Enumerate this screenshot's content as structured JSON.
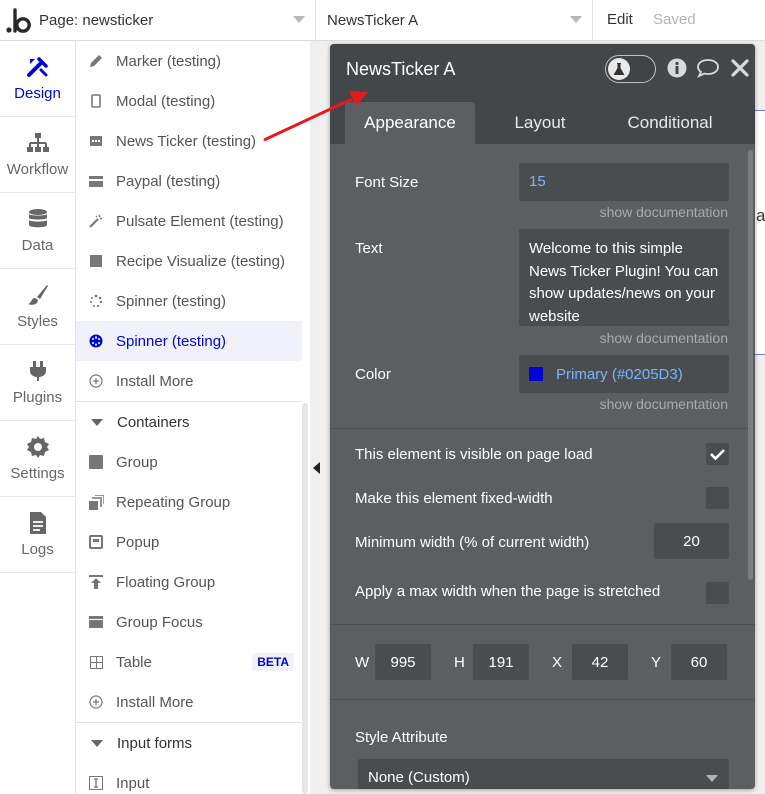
{
  "topbar": {
    "page_label": "Page: newsticker",
    "element_label": "NewsTicker A",
    "edit_label": "Edit",
    "saved_label": "Saved"
  },
  "leftnav": {
    "items": [
      {
        "label": "Design",
        "icon": "design-icon",
        "active": true
      },
      {
        "label": "Workflow",
        "icon": "workflow-icon"
      },
      {
        "label": "Data",
        "icon": "database-icon"
      },
      {
        "label": "Styles",
        "icon": "brush-icon"
      },
      {
        "label": "Plugins",
        "icon": "plug-icon"
      },
      {
        "label": "Settings",
        "icon": "gear-icon"
      },
      {
        "label": "Logs",
        "icon": "document-icon"
      }
    ]
  },
  "element_list": {
    "visual_items": [
      {
        "label": "Marker (testing)",
        "icon": "pencil-icon"
      },
      {
        "label": "Modal (testing)",
        "icon": "phone-icon"
      },
      {
        "label": "News Ticker (testing)",
        "icon": "ticker-icon"
      },
      {
        "label": "Paypal (testing)",
        "icon": "card-icon"
      },
      {
        "label": "Pulsate Element (testing)",
        "icon": "wand-icon"
      },
      {
        "label": "Recipe Visualize (testing)",
        "icon": "square-icon"
      },
      {
        "label": "Spinner (testing)",
        "icon": "spinner-icon"
      },
      {
        "label": "Spinner (testing)",
        "icon": "spinner-filled-icon",
        "selected": true
      },
      {
        "label": "Install More",
        "icon": "plus-circle-icon"
      }
    ],
    "containers_header": "Containers",
    "containers": [
      {
        "label": "Group",
        "icon": "group-icon"
      },
      {
        "label": "Repeating Group",
        "icon": "repeating-group-icon"
      },
      {
        "label": "Popup",
        "icon": "popup-icon"
      },
      {
        "label": "Floating Group",
        "icon": "floating-group-icon"
      },
      {
        "label": "Group Focus",
        "icon": "group-focus-icon"
      },
      {
        "label": "Table",
        "icon": "table-icon",
        "badge": "BETA"
      },
      {
        "label": "Install More",
        "icon": "plus-circle-icon"
      }
    ],
    "input_forms_header": "Input forms",
    "input_forms": [
      {
        "label": "Input",
        "icon": "input-icon"
      }
    ]
  },
  "canvas": {
    "fragment_text": "ai"
  },
  "editor": {
    "title": "NewsTicker A",
    "tabs": [
      "Appearance",
      "Layout",
      "Conditional"
    ],
    "font_size": {
      "label": "Font Size",
      "value": "15"
    },
    "text": {
      "label": "Text",
      "value": "Welcome to this simple News Ticker Plugin! You can show updates/news on your website"
    },
    "color": {
      "label": "Color",
      "value": "Primary (#0205D3)",
      "swatch": "#0205D3"
    },
    "doc_link": "show documentation",
    "visible_on_load": {
      "label": "This element is visible on page load",
      "checked": true
    },
    "fixed_width": {
      "label": "Make this element fixed-width",
      "checked": false
    },
    "min_width": {
      "label": "Minimum width (% of current width)",
      "value": "20"
    },
    "max_width": {
      "label": "Apply a max width when the page is stretched",
      "checked": false
    },
    "dimensions": {
      "w_label": "W",
      "w_value": "995",
      "h_label": "H",
      "h_value": "191",
      "x_label": "X",
      "x_value": "42",
      "y_label": "Y",
      "y_value": "60"
    },
    "style_attribute": {
      "label": "Style Attribute",
      "value": "None (Custom)"
    }
  },
  "colors": {
    "brand": "#0205D3",
    "editor_bg": "#5C5F62",
    "editor_header": "#43474A",
    "annotation": "#E21B1B"
  }
}
